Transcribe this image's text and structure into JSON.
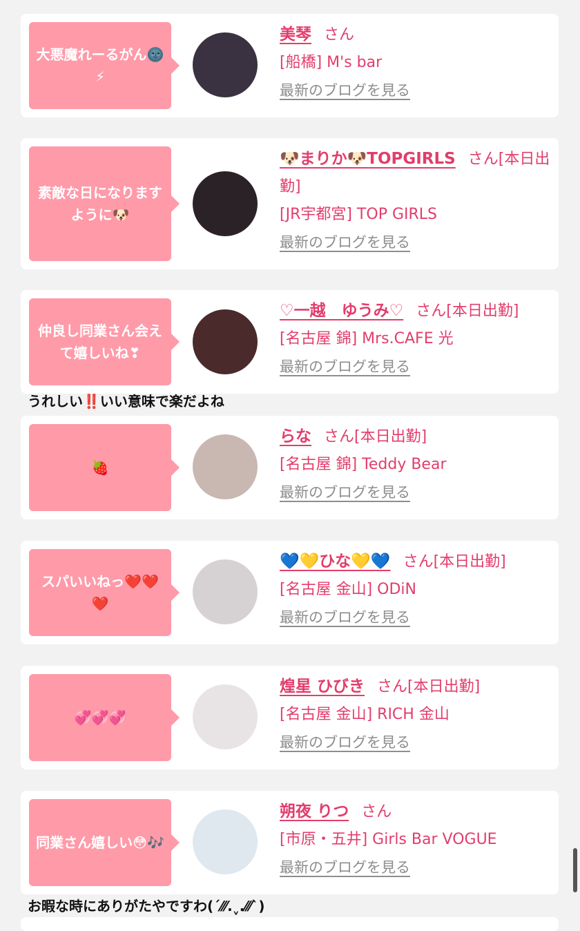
{
  "colors": {
    "background": "#f2f2f2",
    "card": "#ffffff",
    "bubble": "#ff9aa9",
    "name": "#e23d6c",
    "blog_link": "#8d8d8d"
  },
  "blog_link_label": "最新のブログを見る",
  "cards": [
    {
      "message": "大悪魔れーるがん🌚⚡",
      "name": "美琴",
      "suffix": "さん",
      "store": "[船橋] M's bar",
      "avatar_color": "#3a3240"
    },
    {
      "message": "素敵な日になりますように🐶",
      "name": "🐶まりか🐶TOPGIRLS",
      "suffix": "さん[本日出勤]",
      "store": "[JR宇都宮] TOP GIRLS",
      "avatar_color": "#2b2228"
    },
    {
      "message": "仲良し同業さん会えて嬉しいね❣",
      "name": "♡一越　ゆうみ♡",
      "suffix": "さん[本日出勤]",
      "store": "[名古屋 錦] Mrs.CAFE 光",
      "avatar_color": "#4a2a2a"
    },
    {
      "message": "🍓",
      "name": "らな",
      "suffix": "さん[本日出勤]",
      "store": "[名古屋 錦] Teddy Bear",
      "avatar_color": "#c9b7b2"
    },
    {
      "message": "スパいいねっ❤️❤️❤️",
      "name": "💙💛ひな💛💙",
      "suffix": "さん[本日出勤]",
      "store": "[名古屋 金山] ODiN",
      "avatar_color": "#d6d2d4"
    },
    {
      "message": "💞💞💞",
      "name": "煌星 ひびき",
      "suffix": "さん[本日出勤]",
      "store": "[名古屋 金山] RICH 金山",
      "avatar_color": "#e8e4e6"
    },
    {
      "message": "同業さん嬉しい😳🎶",
      "name": "朔夜 りつ",
      "suffix": "さん",
      "store": "[市原・五井] Girls Bar VOGUE",
      "avatar_color": "#dfe7ef"
    }
  ],
  "comments": [
    "うれしい‼️いい意味で楽だよね",
    "お暇な時にありがたやですわ(ˊ⁄⁄⁄.ˬ.⁄⁄⁄ˋ)"
  ]
}
